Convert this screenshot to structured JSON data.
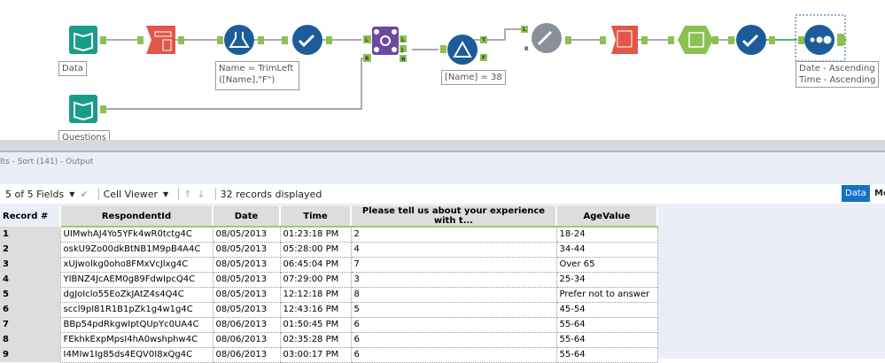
{
  "canvas": {
    "labels": {
      "data_input": "Data",
      "formula": "Name = TrimLeft\n([Name],\"F\")",
      "filter": "[Name] = 38",
      "questions_input": "Questions",
      "sort": "Date - Ascending\nTime - Ascending"
    },
    "join_ports": {
      "l": "L",
      "j": "J",
      "r": "R"
    },
    "filter_ports": {
      "t": "T",
      "f": "F"
    },
    "append_ports": {
      "l": "L",
      "r": "R"
    }
  },
  "results": {
    "title": "lts - Sort (141) - Output",
    "toolbar": {
      "fields": "5 of 5 Fields",
      "viewer": "Cell Viewer",
      "count": "32 records displayed",
      "data_tab": "Data",
      "meta_tab": "Me"
    },
    "columns": [
      "Record #",
      "RespondentId",
      "Date",
      "Time",
      "Please tell us about your experience with t...",
      "AgeValue"
    ],
    "rows": [
      [
        "1",
        "UIMwhAJ4Yo5YFk4wR0tctg4C",
        "08/05/2013",
        "01:23:18 PM",
        "2",
        "18-24"
      ],
      [
        "2",
        "oskU9Zo00dkBtNB1M9pB4A4C",
        "08/05/2013",
        "05:28:00 PM",
        "4",
        "34-44"
      ],
      [
        "3",
        "xUJwolkg0oho8FMxVcJlxg4C",
        "08/05/2013",
        "06:45:04 PM",
        "7",
        "Over 65"
      ],
      [
        "4",
        "YIBNZ4JcAEM0g89FdwIpcQ4C",
        "08/05/2013",
        "07:29:00 PM",
        "3",
        "25-34"
      ],
      [
        "5",
        "dgJoIclo55EoZkJAtZ4s4Q4C",
        "08/05/2013",
        "12:12:18 PM",
        "8",
        "Prefer not to answer"
      ],
      [
        "6",
        "sccl9pI81R1B1pZk1g4w1g4C",
        "08/05/2013",
        "12:43:16 PM",
        "5",
        "45-54"
      ],
      [
        "7",
        "BBp54pdRkgwIptQUpYc0UA4C",
        "08/06/2013",
        "01:50:45 PM",
        "6",
        "55-64"
      ],
      [
        "8",
        "FEkhkExpMpsI4hA0wshphw4C",
        "08/06/2013",
        "02:35:28 PM",
        "6",
        "55-64"
      ],
      [
        "9",
        "I4MIw1Ig85ds4EQV0I8xQg4C",
        "08/06/2013",
        "03:00:17 PM",
        "6",
        "55-64"
      ]
    ]
  },
  "colors": {
    "teal": "#1a9c8a",
    "red": "#e0574a",
    "blue": "#1c5c9a",
    "purple": "#6b4a9e",
    "green": "#8cc152",
    "gray": "#8a9099",
    "accent": "#1570c8"
  }
}
